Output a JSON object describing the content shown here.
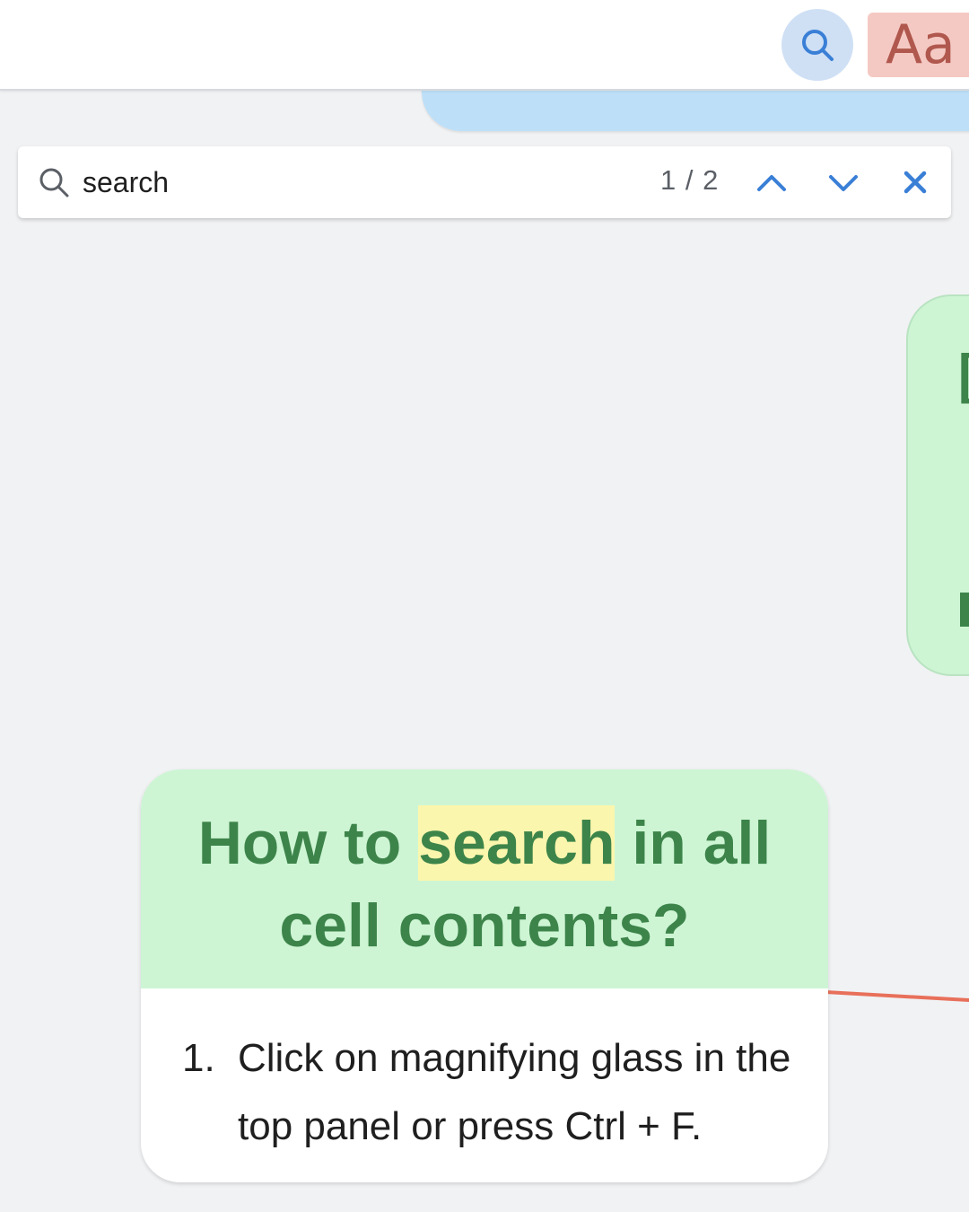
{
  "top_panel": {
    "search_icon": "magnifying-glass-icon",
    "font_button_label": "Aa"
  },
  "search_bar": {
    "icon": "search-icon",
    "query": "search",
    "match_counter": "1 / 2",
    "prev_icon": "chevron-up-icon",
    "next_icon": "chevron-down-icon",
    "close_icon": "close-icon"
  },
  "main_cell": {
    "title_before": "How to ",
    "title_match": "search",
    "title_after": " in all cell contents?",
    "steps": [
      {
        "number": "1.",
        "text": "Click on magnifying glass in the top panel or press Ctrl + F."
      }
    ]
  },
  "colors": {
    "accent_blue": "#3a7fd6",
    "title_green": "#3d844a",
    "header_green": "#cdf5d4",
    "highlight_yellow": "#fbf6ad",
    "connector_red": "#e8705a",
    "font_button_bg": "#f5c9c3"
  }
}
